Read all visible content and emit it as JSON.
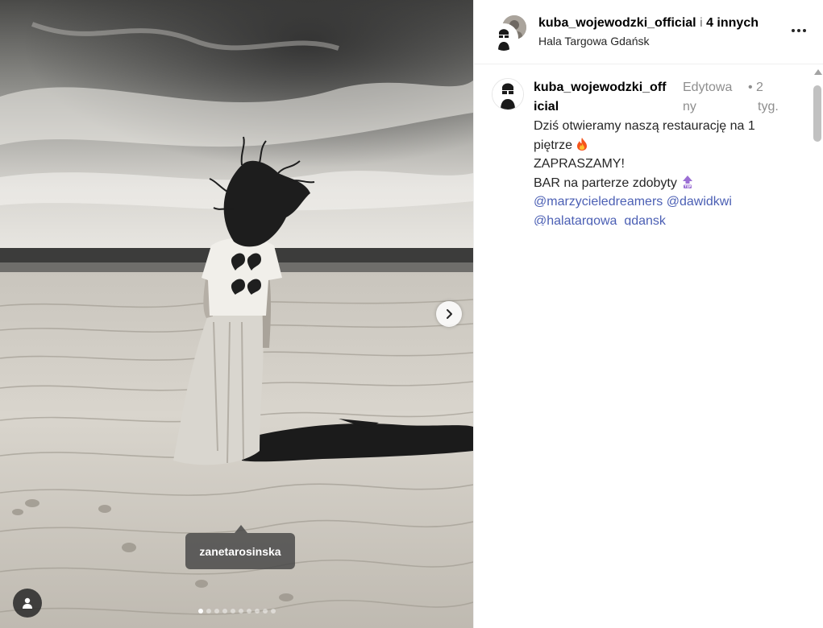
{
  "photo": {
    "tag_label": "zanetarosinska",
    "carousel_total": 10,
    "carousel_active": 0,
    "next_icon": "chevron-right-icon",
    "user_tags_icon": "person-icon"
  },
  "header": {
    "username": "kuba_wojewodzki_official",
    "separator": "i",
    "others": "4 innych",
    "location": "Hala Targowa Gdańsk",
    "more_icon": "more-horizontal-icon"
  },
  "caption": {
    "username_a": "kuba_wojewodzki_off",
    "username_b": "icial",
    "edited_a": "Edytowa",
    "edited_b": "ny",
    "time_a": "•  2",
    "time_b": "tyg.",
    "line1": "Dziś otwieramy naszą restaurację na 1",
    "line2": "piętrze",
    "line2_icon": "fire-emoji",
    "line3": "ZAPRASZAMY!",
    "line4": "BAR na parterze zdobyty",
    "line4_icon": "top-arrow-emoji",
    "mention1": "@marzycieledreamers",
    "mention2": "@dawidkwi",
    "mention3": "@halatargowa_gdansk"
  },
  "colors": {
    "mention": "#4b5fb4",
    "muted": "#8e8e8e",
    "divider": "#efefef"
  }
}
